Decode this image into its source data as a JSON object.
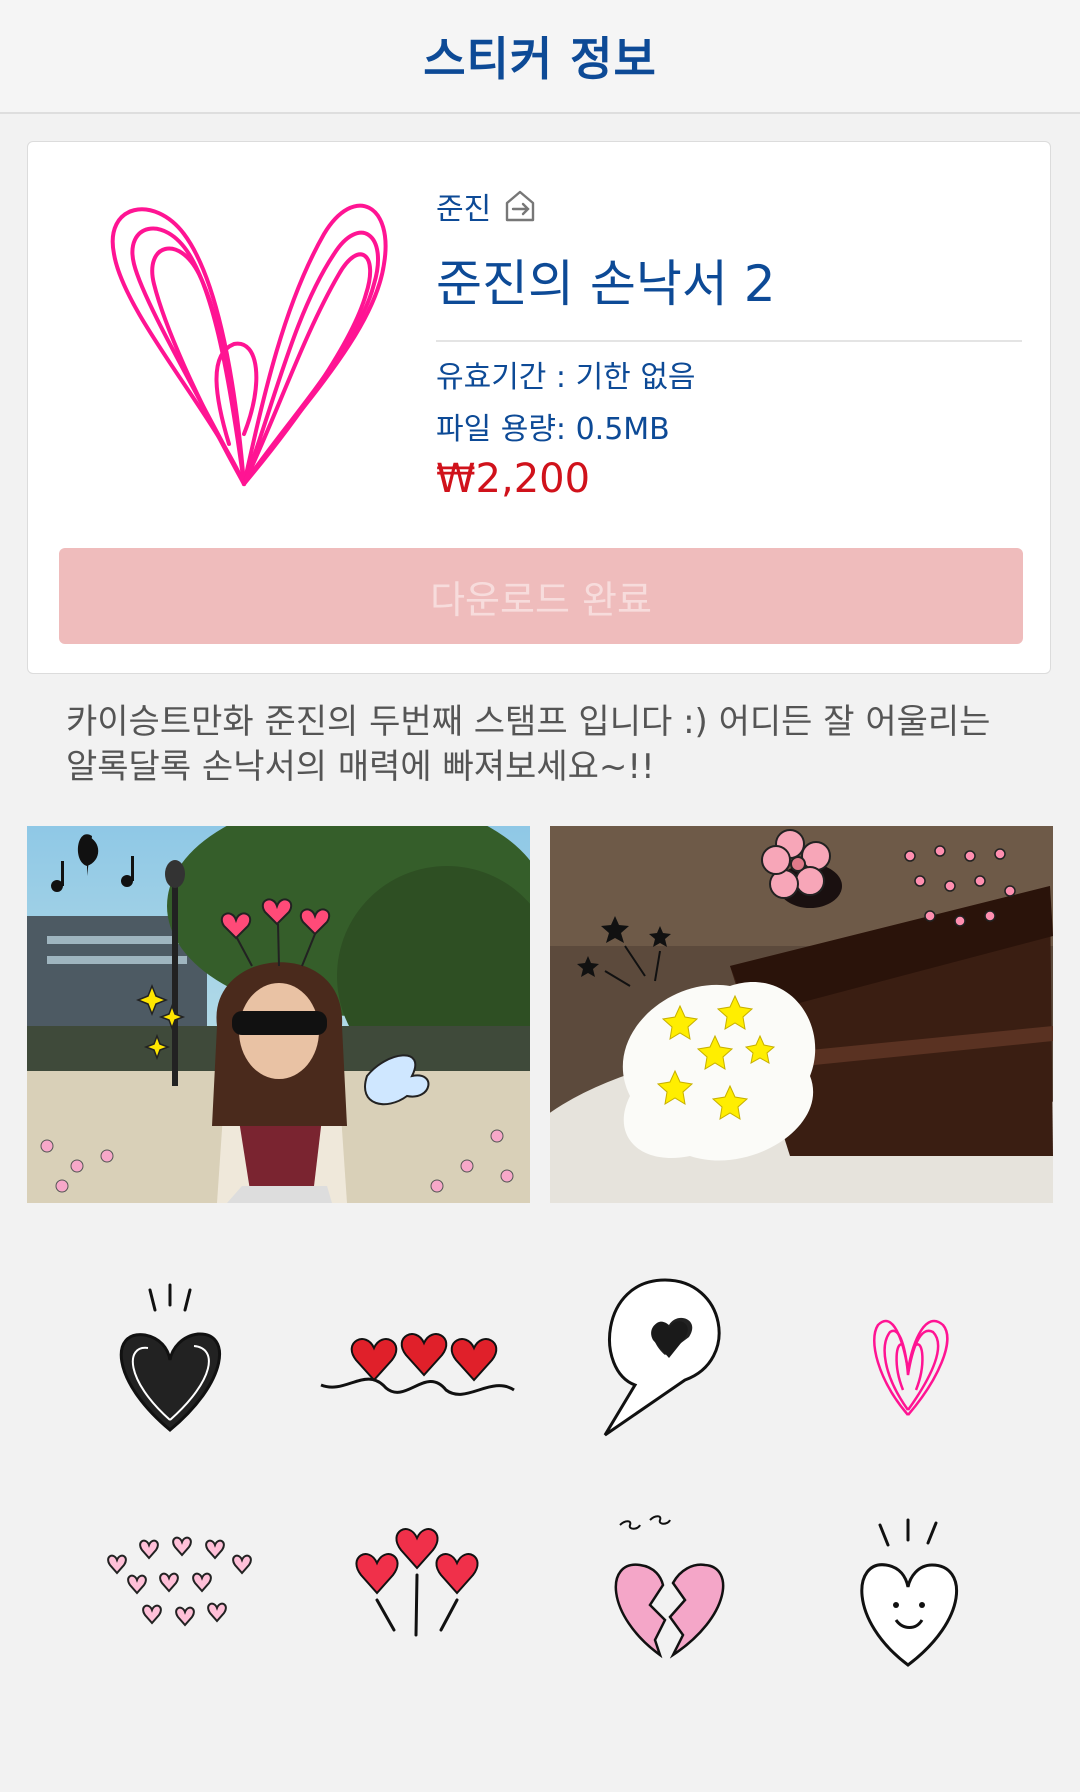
{
  "header": {
    "title": "스티커 정보"
  },
  "pack": {
    "author": "준진",
    "title": "준진의 손낙서 2",
    "validity": "유효기간 : 기한 없음",
    "file_size": "파일 용량: 0.5MB",
    "price": "₩2,200",
    "download_button": "다운로드 완료"
  },
  "description": "카이승트만화 준진의 두번째 스탬프 입니다 :) 어디든 잘 어울리는 알록달록 손낙서의 매력에 빠져보세요~!!",
  "stickers": [
    "black-heart-sticker",
    "three-red-hearts-sticker",
    "speech-bubble-heart-sticker",
    "pink-heart-sticker",
    "pink-hearts-cluster-sticker",
    "heart-lollipops-sticker",
    "broken-heart-sticker",
    "smiling-heart-sticker"
  ],
  "colors": {
    "brand_blue": "#0d4a96",
    "price_red": "#d0121b",
    "button_pink": "#efbcbc",
    "heart_pink": "#ff1493"
  }
}
